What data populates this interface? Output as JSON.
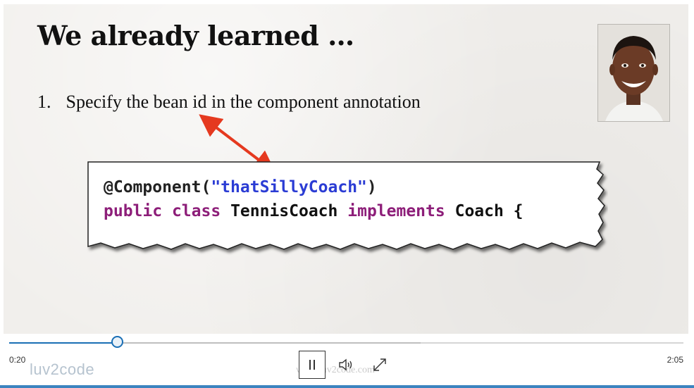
{
  "slide": {
    "title": "We already learned …",
    "bullet_number": "1.",
    "bullet_text": "Specify the bean id in the component annotation",
    "code": {
      "annotation": "@Component(",
      "string_value": "\"thatSillyCoach\"",
      "annotation_close": ")",
      "kw_public": "public",
      "kw_class": "class",
      "class_name": "TennisCoach",
      "kw_implements": "implements",
      "interface_name": "Coach {"
    },
    "arrow_color": "#e5391f"
  },
  "player": {
    "current_time": "0:20",
    "total_time": "2:05",
    "progress_fraction": 0.16,
    "buffered_fraction": 0.61,
    "logo_text": "luv2code",
    "watermark_text": "www.luv2code.com",
    "accent_color": "#1a6fb5"
  }
}
